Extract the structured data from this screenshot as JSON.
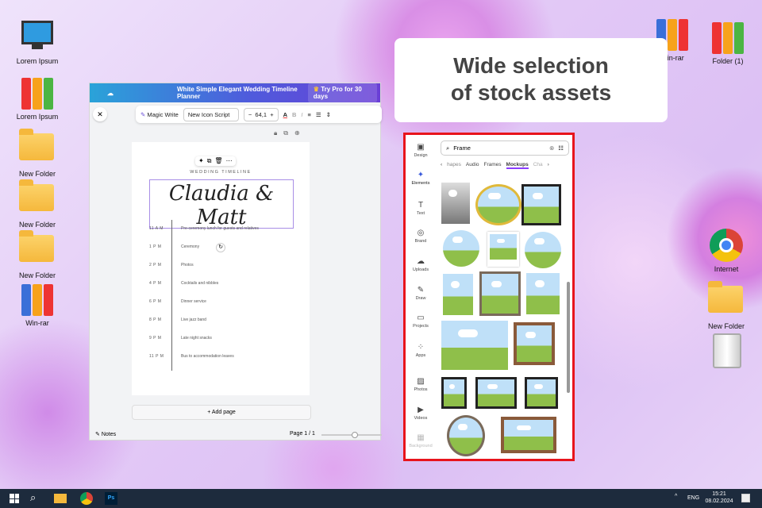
{
  "desktop": {
    "left_icons": [
      "Lorem Ipsum",
      "Lorem Ipsum",
      "New Folder",
      "New Folder",
      "New Folder",
      "Win-rar"
    ],
    "right_icons": [
      "Win-rar",
      "Folder (1)",
      "Internet",
      "New Folder"
    ]
  },
  "callout": {
    "line1": "Wide selection",
    "line2": "of stock assets"
  },
  "canva": {
    "title": "White Simple Elegant Wedding Timeline Planner",
    "pro": "Try Pro for 30 days",
    "toolbar": {
      "magic_write": "Magic Write",
      "font": "New Icon Script",
      "size": "64,1",
      "minus": "−",
      "plus": "+"
    },
    "page": {
      "heading": "WEDDING TIMELINE",
      "names": "Claudia & Matt",
      "timeline": [
        {
          "time": "11 A M",
          "event": "Pre-ceremony lunch for guests and relatives"
        },
        {
          "time": "1 P M",
          "event": "Ceremony"
        },
        {
          "time": "2 P M",
          "event": "Photos"
        },
        {
          "time": "4 P M",
          "event": "Cocktails and nibbles"
        },
        {
          "time": "6 P M",
          "event": "Dinner service"
        },
        {
          "time": "8 P M",
          "event": "Live jazz band"
        },
        {
          "time": "9 P M",
          "event": "Late night snacks"
        },
        {
          "time": "11 P M",
          "event": "Bus to accommodation leaves"
        }
      ]
    },
    "add_page": "+ Add page",
    "notes": "Notes",
    "page_indicator": "Page 1 / 1"
  },
  "panel": {
    "search": "Frame",
    "tabs": [
      "hapes",
      "Audio",
      "Frames",
      "Mockups",
      "Cha"
    ],
    "active_tab": "Mockups",
    "sidebar": [
      "Design",
      "Elements",
      "Text",
      "Brand",
      "Uploads",
      "Draw",
      "Projects",
      "Apps",
      "Photos",
      "Videos",
      "Background"
    ]
  },
  "taskbar": {
    "lang": "ENG",
    "time": "15:21",
    "date": "08.02.2024",
    "ps": "Ps"
  }
}
